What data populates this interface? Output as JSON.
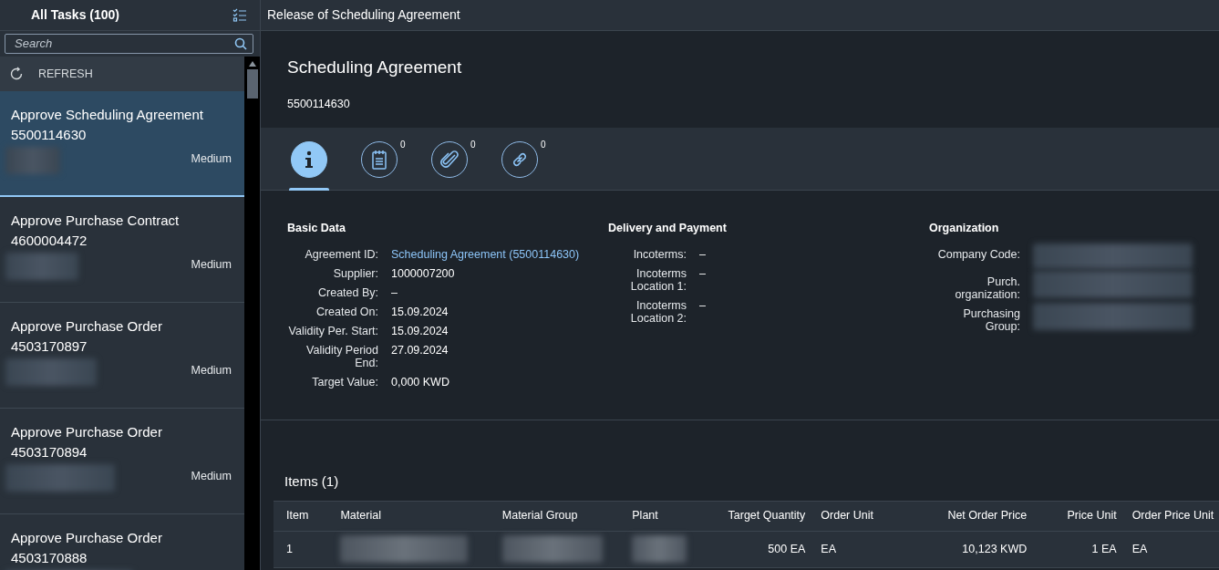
{
  "master": {
    "title": "All Tasks (100)",
    "search": {
      "placeholder": "Search"
    },
    "refresh": "REFRESH",
    "tasks": [
      {
        "title": "Approve Scheduling Agreement",
        "number": "5500114630",
        "priority": "Medium",
        "selected": true
      },
      {
        "title": "Approve Purchase Contract",
        "number": "4600004472",
        "priority": "Medium",
        "selected": false
      },
      {
        "title": "Approve Purchase Order",
        "number": "4503170897",
        "priority": "Medium",
        "selected": false
      },
      {
        "title": "Approve Purchase Order",
        "number": "4503170894",
        "priority": "Medium",
        "selected": false
      },
      {
        "title": "Approve Purchase Order",
        "number": "4503170888",
        "selected": false
      }
    ]
  },
  "detail": {
    "title": "Release of Scheduling Agreement",
    "object_title": "Scheduling Agreement",
    "object_number": "5500114630",
    "tabs": [
      {
        "kind": "info",
        "selected": true
      },
      {
        "kind": "notes",
        "count": "0",
        "selected": false
      },
      {
        "kind": "attachments",
        "count": "0",
        "selected": false
      },
      {
        "kind": "links",
        "count": "0",
        "selected": false
      }
    ],
    "groups": [
      {
        "title": "Basic Data",
        "fields": [
          {
            "label": "Agreement ID:",
            "value": "Scheduling Agreement (5500114630)",
            "kind": "link"
          },
          {
            "label": "Supplier:",
            "value": "1000007200",
            "kind": "text"
          },
          {
            "label": "Created By:",
            "value": "–",
            "kind": "text"
          },
          {
            "label": "Created On:",
            "value": "15.09.2024",
            "kind": "text"
          },
          {
            "label": "Validity Per. Start:",
            "value": "15.09.2024",
            "kind": "text"
          },
          {
            "label": "Validity Period End:",
            "value": "27.09.2024",
            "kind": "text"
          },
          {
            "label": "Target Value:",
            "value": "0,000  KWD",
            "kind": "text"
          }
        ]
      },
      {
        "title": "Delivery and Payment",
        "fields": [
          {
            "label": "Incoterms:",
            "value": "–",
            "kind": "text"
          },
          {
            "label": "Incoterms Location 1:",
            "value": "–",
            "kind": "text"
          },
          {
            "label": "Incoterms Location 2:",
            "value": "–",
            "kind": "text"
          }
        ]
      },
      {
        "title": "Organization",
        "fields": [
          {
            "label": "Company Code:",
            "kind": "redacted"
          },
          {
            "label": "Purch. organization:",
            "kind": "redacted"
          },
          {
            "label": "Purchasing Group:",
            "kind": "redacted"
          }
        ]
      }
    ],
    "items": {
      "title": "Items (1)",
      "columns": [
        {
          "label": "Item",
          "right_aligned": false
        },
        {
          "label": "Material",
          "right_aligned": false
        },
        {
          "label": "Material Group",
          "right_aligned": false
        },
        {
          "label": "Plant",
          "right_aligned": false
        },
        {
          "label": "Target Quantity",
          "right_aligned": true
        },
        {
          "label": "Order Unit",
          "right_aligned": false
        },
        {
          "label": "Net Order Price",
          "right_aligned": true
        },
        {
          "label": "Price Unit",
          "right_aligned": true
        },
        {
          "label": "Order Price Unit",
          "right_aligned": false
        }
      ],
      "rows": [
        [
          {
            "text": "1",
            "redacted": false
          },
          {
            "redacted": true
          },
          {
            "redacted": true
          },
          {
            "redacted": true
          },
          {
            "text": "500 EA",
            "redacted": false
          },
          {
            "text": "EA",
            "redacted": false
          },
          {
            "text": "10,123  KWD",
            "redacted": false
          },
          {
            "text": "1 EA",
            "redacted": false
          },
          {
            "text": "EA",
            "redacted": false
          }
        ]
      ]
    }
  }
}
